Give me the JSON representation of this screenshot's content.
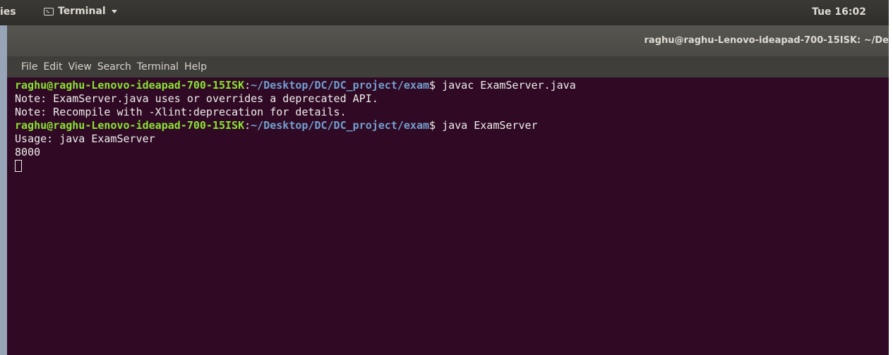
{
  "top_panel": {
    "activities": "ies",
    "app_name": "Terminal",
    "clock": "Tue 16:02"
  },
  "window": {
    "title": "raghu@raghu-Lenovo-ideapad-700-15ISK: ~/De"
  },
  "menu": [
    "File",
    "Edit",
    "View",
    "Search",
    "Terminal",
    "Help"
  ],
  "terminal": {
    "prompt_user": "raghu@raghu-Lenovo-ideapad-700-15ISK",
    "prompt_path": "~/Desktop/DC/DC_project/exam",
    "cmd1": "javac ExamServer.java",
    "out1": "Note: ExamServer.java uses or overrides a deprecated API.",
    "out2": "Note: Recompile with -Xlint:deprecation for details.",
    "cmd2": "java ExamServer",
    "out3": "Usage: java ExamServer",
    "out4": "8000"
  },
  "colors": {
    "terminal_bg": "#300a24",
    "prompt_user": "#8ae234",
    "prompt_path": "#729fcf"
  },
  "icons": [
    "terminal-icon",
    "chevron-down-icon"
  ]
}
